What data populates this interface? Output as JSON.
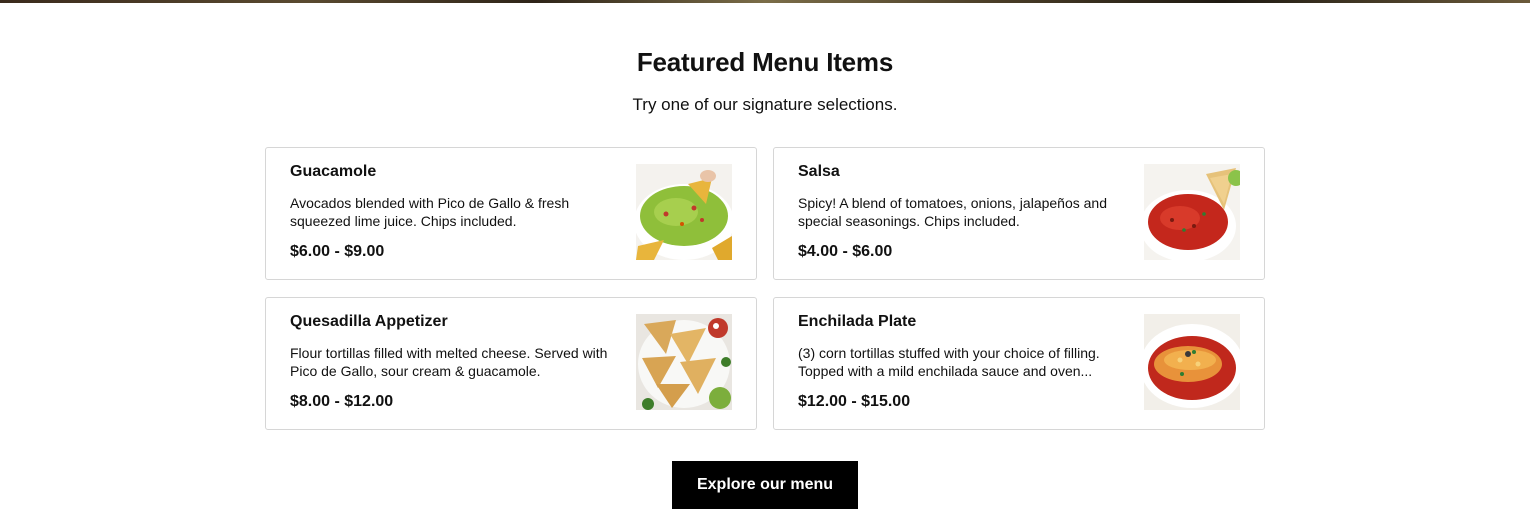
{
  "section": {
    "title": "Featured Menu Items",
    "subtitle": "Try one of our signature selections."
  },
  "items": [
    {
      "name": "Guacamole",
      "description": "Avocados blended with Pico de Gallo & fresh squeezed lime juice. Chips included.",
      "price": "$6.00 - $9.00",
      "image": "guacamole-photo"
    },
    {
      "name": "Salsa",
      "description": "Spicy! A blend of tomatoes, onions, jalapeños and special seasonings. Chips included.",
      "price": "$4.00 - $6.00",
      "image": "salsa-photo"
    },
    {
      "name": "Quesadilla Appetizer",
      "description": "Flour tortillas filled with melted cheese. Served with Pico de Gallo, sour cream & guacamole.",
      "price": "$8.00 - $12.00",
      "image": "quesadilla-photo"
    },
    {
      "name": "Enchilada Plate",
      "description": "(3) corn tortillas stuffed with your choice of filling. Topped with a mild enchilada sauce and oven...",
      "price": "$12.00 - $15.00",
      "image": "enchilada-photo"
    }
  ],
  "cta": {
    "label": "Explore our menu"
  }
}
